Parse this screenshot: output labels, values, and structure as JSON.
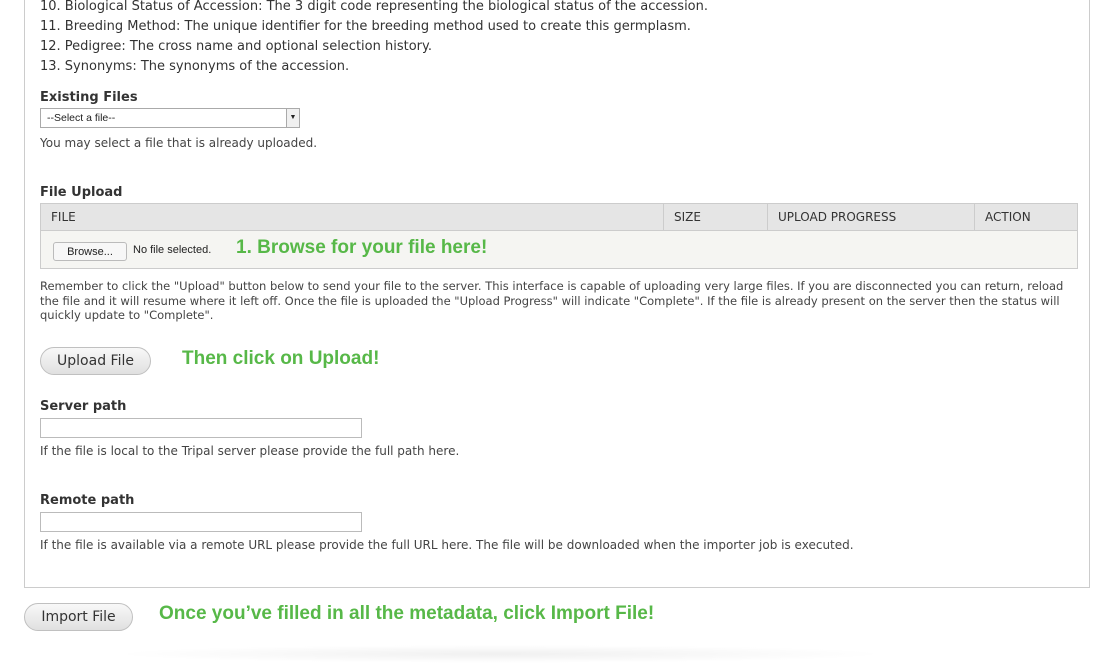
{
  "list_items": [
    "10. Biological Status of Accession: The 3 digit code representing the biological status of the accession.",
    "11. Breeding Method: The unique identifier for the breeding method used to create this germplasm.",
    "12. Pedigree: The cross name and optional selection history.",
    "13. Synonyms: The synonyms of the accession."
  ],
  "existing_files": {
    "label": "Existing Files",
    "selected": "--Select a file--",
    "description": "You may select a file that is already uploaded."
  },
  "file_upload": {
    "label": "File Upload",
    "columns": [
      "FILE",
      "SIZE",
      "UPLOAD PROGRESS",
      "ACTION"
    ],
    "browse_label": "Browse...",
    "no_file_text": "No file selected.",
    "annotation": "1. Browse for your file here!",
    "description": "Remember to click the \"Upload\" button below to send your file to the server. This interface is capable of uploading very large files. If you are disconnected you can return, reload the file and it will resume where it left off. Once the file is uploaded the \"Upload Progress\" will indicate \"Complete\". If the file is already present on the server then the status will quickly update to \"Complete\".",
    "upload_button": "Upload File",
    "upload_annotation": "Then click on Upload!"
  },
  "server_path": {
    "label": "Server path",
    "description": "If the file is local to the Tripal server please provide the full path here."
  },
  "remote_path": {
    "label": "Remote path",
    "description": "If the file is available via a remote URL please provide the full URL here. The file will be downloaded when the importer job is executed."
  },
  "import": {
    "button": "Import File",
    "annotation": "Once you’ve filled in all the metadata, click Import File!"
  },
  "colors": {
    "annotation_green": "#57b848",
    "header_bg": "#e5e5e5",
    "border": "#cccccc"
  }
}
